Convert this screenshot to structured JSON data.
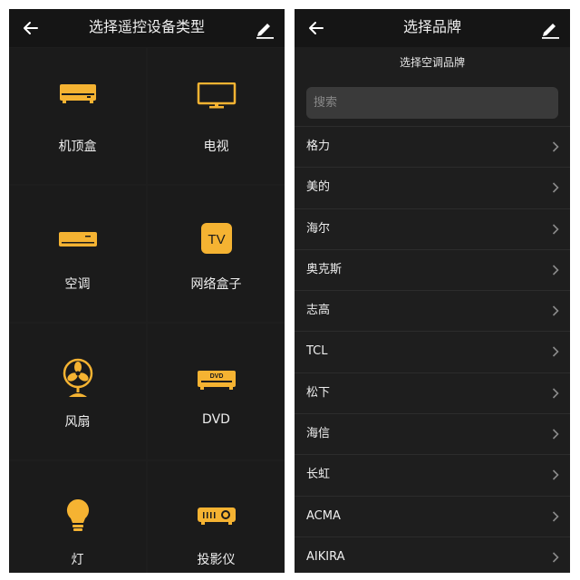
{
  "left_screen": {
    "title": "选择遥控设备类型",
    "devices": [
      {
        "label": "机顶盒",
        "icon": "set-top-box-icon"
      },
      {
        "label": "电视",
        "icon": "tv-icon"
      },
      {
        "label": "空调",
        "icon": "air-conditioner-icon"
      },
      {
        "label": "网络盒子",
        "icon": "network-box-icon",
        "badge": "TV"
      },
      {
        "label": "风扇",
        "icon": "fan-icon"
      },
      {
        "label": "DVD",
        "icon": "dvd-icon",
        "badge": "DVD"
      },
      {
        "label": "灯",
        "icon": "light-bulb-icon"
      },
      {
        "label": "投影仪",
        "icon": "projector-icon"
      }
    ]
  },
  "right_screen": {
    "title": "选择品牌",
    "subtitle": "选择空调品牌",
    "search": {
      "placeholder": "搜索",
      "value": ""
    },
    "brands": [
      "格力",
      "美的",
      "海尔",
      "奥克斯",
      "志高",
      "TCL",
      "松下",
      "海信",
      "长虹",
      "ACMA",
      "AIKIRA"
    ]
  },
  "colors": {
    "accent": "#f5b332",
    "background": "#1e1e1e",
    "header": "#151515",
    "text": "#eeeeee"
  }
}
